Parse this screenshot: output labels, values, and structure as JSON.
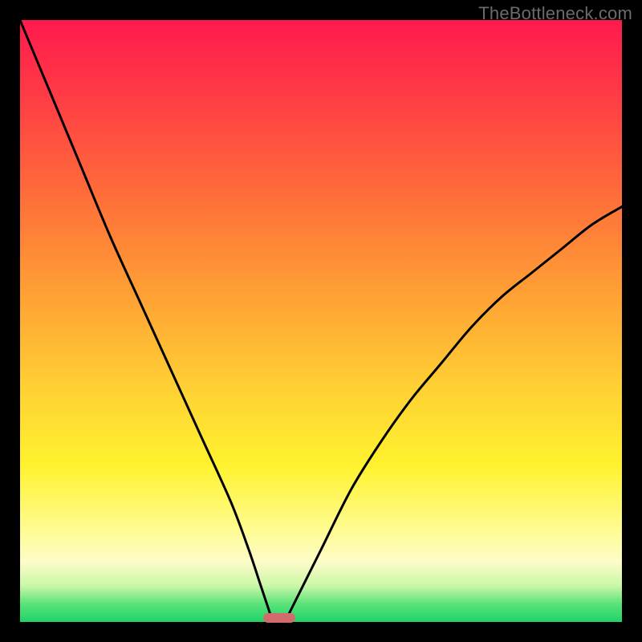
{
  "watermark": "TheBottleneck.com",
  "chart_data": {
    "type": "line",
    "title": "",
    "xlabel": "",
    "ylabel": "",
    "xlim": [
      0,
      100
    ],
    "ylim": [
      0,
      100
    ],
    "grid": false,
    "legend": false,
    "x": [
      0,
      5,
      10,
      15,
      20,
      25,
      30,
      35,
      38,
      40,
      42,
      44,
      46,
      50,
      55,
      60,
      65,
      70,
      75,
      80,
      85,
      90,
      95,
      100
    ],
    "series": [
      {
        "name": "left-branch",
        "x": [
          0,
          5,
          10,
          15,
          20,
          25,
          30,
          35,
          38,
          40,
          42
        ],
        "values": [
          100,
          88,
          76,
          64,
          53,
          42,
          31,
          20,
          12,
          6,
          0
        ]
      },
      {
        "name": "right-branch",
        "x": [
          44,
          46,
          50,
          55,
          60,
          65,
          70,
          75,
          80,
          85,
          90,
          95,
          100
        ],
        "values": [
          0,
          4,
          12,
          22,
          30,
          37,
          43,
          49,
          54,
          58,
          62,
          66,
          69
        ]
      }
    ],
    "marker": {
      "x": 43,
      "label": ""
    },
    "gradient_stops": [
      {
        "pos": 0,
        "color": "#ff1a4e"
      },
      {
        "pos": 50,
        "color": "#ffb733"
      },
      {
        "pos": 80,
        "color": "#fff654"
      },
      {
        "pos": 95,
        "color": "#7ee88a"
      },
      {
        "pos": 100,
        "color": "#1fd36a"
      }
    ]
  },
  "layout": {
    "image_size": 800,
    "plot_inset": 25,
    "plot_size": 750
  }
}
